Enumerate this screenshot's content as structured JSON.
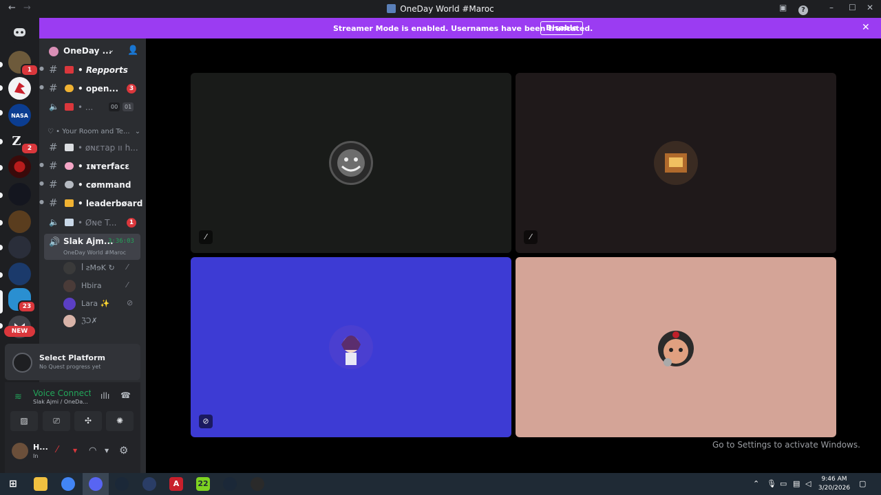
{
  "window": {
    "title": "OneDay World #Maroc"
  },
  "banner": {
    "text": "Streamer Mode is enabled. Usernames have been truncated.",
    "button": "Disable"
  },
  "guilds": {
    "badges": [
      "1",
      "2",
      "23"
    ],
    "new_label": "NEW"
  },
  "server": {
    "name": "OneDay ..."
  },
  "channels": [
    {
      "name": "• Repports",
      "type": "text",
      "state": "unread-italic"
    },
    {
      "name": "• open...",
      "type": "text",
      "state": "unread",
      "badge": "3"
    },
    {
      "name": "• ...",
      "type": "voice",
      "state": "muted",
      "counter": [
        "00",
        "01"
      ]
    },
    {
      "name": "• øɴɛтap ıı h...",
      "type": "text",
      "state": "muted"
    },
    {
      "name": "• ɪɴтerfacɛ",
      "type": "text",
      "state": "unread"
    },
    {
      "name": "• cømmand",
      "type": "text",
      "state": "unread"
    },
    {
      "name": "• leaderbøard",
      "type": "text",
      "state": "unread"
    },
    {
      "name": "• Øɴe T...",
      "type": "voice",
      "state": "muted",
      "badge": "1"
    }
  ],
  "category": {
    "label": "♡ • Your Room and Te..."
  },
  "active_voice": {
    "name": "Slak Ajm...",
    "timer": "3:36:03",
    "sub": "OneDay World #Maroc"
  },
  "voice_users": [
    {
      "name": "ꟾ ƨMɘK ↻"
    },
    {
      "name": "Hbira"
    },
    {
      "name": "Lara ✨"
    },
    {
      "name": "ℨƆ✗"
    }
  ],
  "quest": {
    "title": "Select Platform",
    "sub": "No Quest progress yet"
  },
  "voice_connection": {
    "status": "Voice Connected",
    "channel": "Slak Ajmi / OneDa..."
  },
  "user": {
    "name": "H...",
    "status": "In"
  },
  "watermark": "Go to Settings to activate Windows.",
  "taskbar": {
    "time": "9:46 AM",
    "date": "3/20/2026",
    "app22": "22"
  },
  "colors": {
    "accent": "#9b3cf2",
    "voice_green": "#23a55a",
    "tile_1": "#191b19",
    "tile_2": "#1f191a",
    "tile_3": "#3d3bd4",
    "tile_4": "#d4a497"
  }
}
